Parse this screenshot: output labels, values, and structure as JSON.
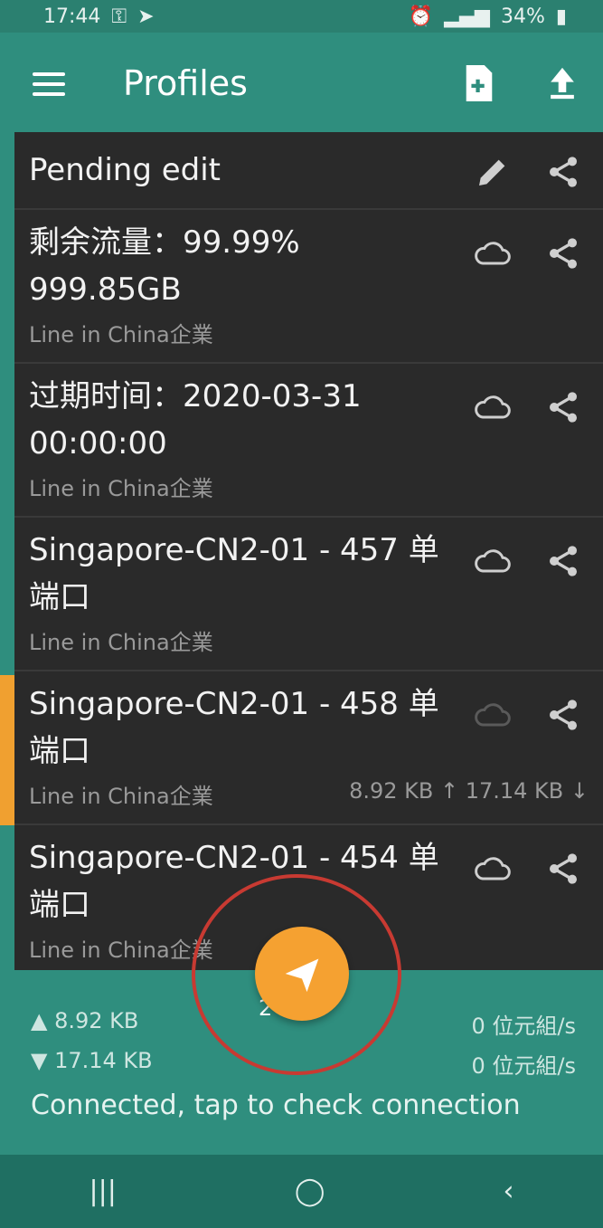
{
  "status_bar": {
    "time": "17:44",
    "battery": "34%"
  },
  "toolbar": {
    "title": "Profiles",
    "new_profile_icon": "file-plus-icon",
    "upload_icon": "upload-icon"
  },
  "profiles": [
    {
      "name": "Pending edit",
      "sub": "",
      "traffic": "",
      "action_icon": "pencil-icon"
    },
    {
      "name": "剩余流量：99.99% 999.85GB",
      "sub": "Line in China企業",
      "traffic": "",
      "action_icon": "cloud-icon"
    },
    {
      "name": "过期时间：2020-03-31 00:00:00",
      "sub": "Line in China企業",
      "traffic": "",
      "action_icon": "cloud-icon"
    },
    {
      "name": "Singapore-CN2-01 - 457 单端口",
      "sub": "Line in China企業",
      "traffic": "",
      "action_icon": "cloud-icon"
    },
    {
      "name": "Singapore-CN2-01 - 458 单端口",
      "sub": "Line in China企業",
      "traffic": "8.92 KB ↑ 17.14 KB ↓",
      "action_icon": "cloud-icon"
    },
    {
      "name": "Singapore-CN2-01 - 454 单端口",
      "sub": "Line in China企業",
      "traffic": "",
      "action_icon": "cloud-icon"
    }
  ],
  "bottom": {
    "up_total": "▲ 8.92 KB",
    "down_total": "▼ 17.14 KB",
    "up_speed": "0 位元組/s",
    "down_speed": "0 位元組/s",
    "obscured_text": "2-01",
    "status": "Connected, tap to check connection"
  },
  "nav": {
    "recents": "|||",
    "home": "◯",
    "back": "‹"
  },
  "colors": {
    "primary": "#2f8e7e",
    "list_bg": "#2a2a2a",
    "accent": "#f5a131",
    "annotation": "#c83a32"
  }
}
